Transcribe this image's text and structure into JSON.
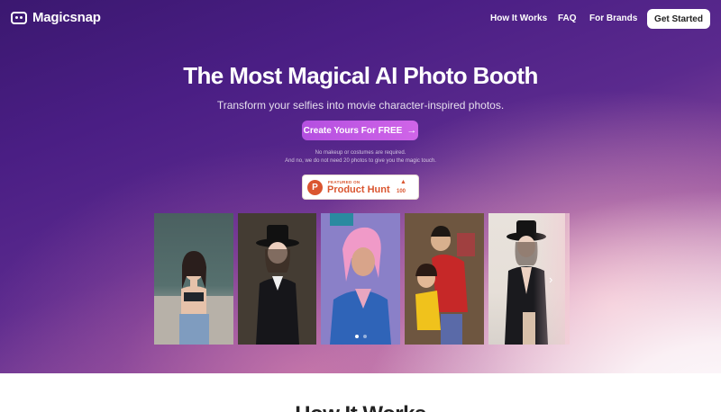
{
  "brand": {
    "name": "Magicsnap",
    "icon": "smiley-icon"
  },
  "nav": {
    "links": [
      "How It Works",
      "FAQ",
      "For Brands"
    ],
    "cta_label": "Get Started"
  },
  "hero": {
    "headline": "The Most Magical AI Photo Booth",
    "subhead": "Transform your selfies into movie character-inspired photos.",
    "cta_label": "Create Yours For FREE",
    "cta_icon": "arrow-right-icon",
    "note_line1": "No makeup or costumes are required.",
    "note_line2": "And no, we do not need 20 photos to give you the magic touch."
  },
  "product_hunt": {
    "featured": "FEATURED ON",
    "name": "Product Hunt",
    "letter": "P",
    "upvotes": "100",
    "color": "#da552f"
  },
  "carousel": {
    "photos": [
      "woman-denim-photo",
      "woman-black-hat-photo",
      "man-pink-hair-photo",
      "couple-hug-photo",
      "woman-black-dress-photo"
    ],
    "active_index": 0,
    "dot_count": 2,
    "next_icon": "chevron-right-icon"
  },
  "next_section": {
    "title": "How It Works"
  },
  "colors": {
    "accent": "#c15de6",
    "hero_top": "#3b1870",
    "hero_bottom": "#f2c8d0"
  }
}
